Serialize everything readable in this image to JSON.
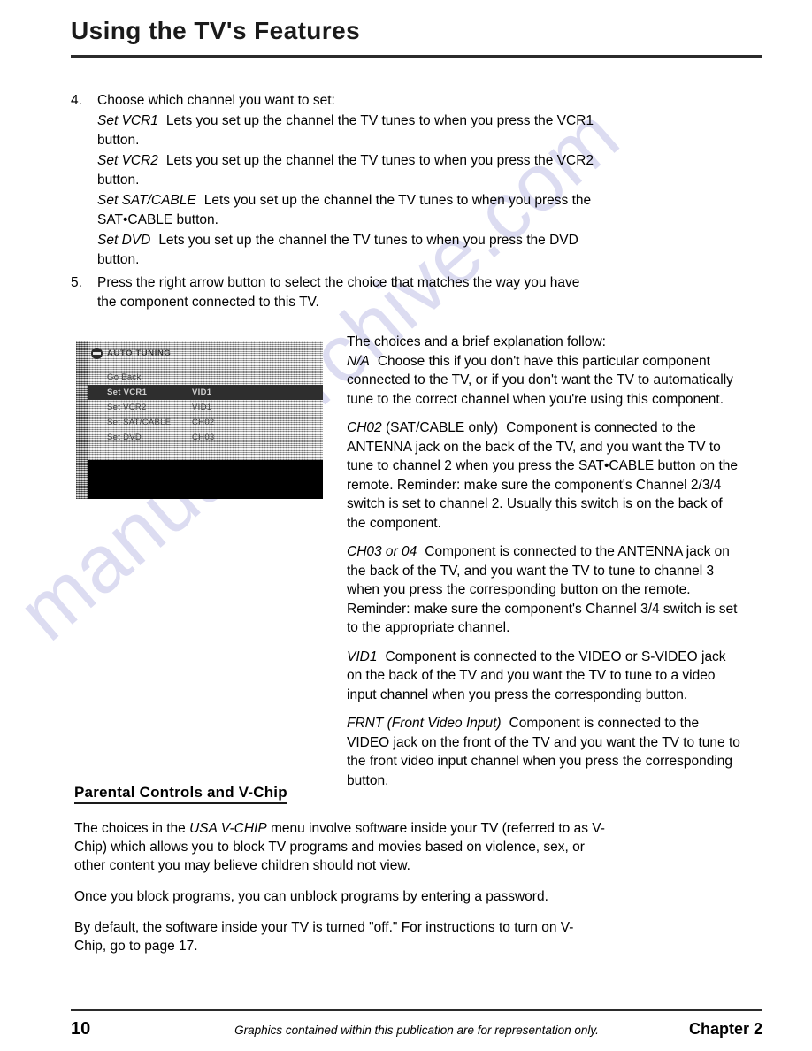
{
  "header": {
    "title": "Using the TV's Features"
  },
  "steps": [
    {
      "number": "4.",
      "text": "Choose which channel you want to set:"
    },
    {
      "number": "5.",
      "text": "Press the right arrow button to select the choice that matches the way you have the component connected to this TV."
    }
  ],
  "set_options": [
    {
      "term": "Set VCR1",
      "desc": "Lets you set up the channel the TV tunes to when you press the VCR1 button."
    },
    {
      "term": "Set VCR2",
      "desc": "Lets you set up the channel the TV tunes to when you press the VCR2 button."
    },
    {
      "term": "Set SAT/CABLE",
      "desc": "Lets you set up the channel the TV tunes to when you press the SAT•CABLE button."
    },
    {
      "term": "Set DVD",
      "desc": "Lets you set up the channel the TV tunes to when you press the DVD button."
    }
  ],
  "tv_menu": {
    "icon": "satellite-dish-icon",
    "title": "AUTO TUNING",
    "go_back": "Go Back",
    "rows": [
      {
        "label": "Set VCR1",
        "value": "VID1",
        "highlighted": true
      },
      {
        "label": "Set VCR2",
        "value": "VID1",
        "highlighted": false
      },
      {
        "label": "Set SAT/CABLE",
        "value": "CH02",
        "highlighted": false
      },
      {
        "label": "Set DVD",
        "value": "CH03",
        "highlighted": false
      }
    ]
  },
  "choices": {
    "intro": "The choices and a brief explanation follow:",
    "items": [
      {
        "term": "N/A",
        "term_plain": "",
        "text": "Choose this if you don't have this particular component connected to the TV, or if you don't want the TV to automatically tune to the correct channel when you're using this component."
      },
      {
        "term": "CH02",
        "term_plain": " (SAT/CABLE only)",
        "text": "Component is connected to the ANTENNA jack on the back of the TV, and you want the TV to tune to channel 2 when you press the SAT•CABLE button on the remote. Reminder: make sure the component's Channel 2/3/4 switch is set to channel 2. Usually this switch is on the back of the component."
      },
      {
        "term": "CH03 or 04",
        "term_plain": "",
        "text": "Component is connected to the ANTENNA jack on the back of the TV, and you want the TV to tune to channel 3 when you press the corresponding button on the remote. Reminder: make sure the component's Channel 3/4 switch is set to the appropriate channel."
      },
      {
        "term": "VID1",
        "term_plain": "",
        "text": "Component is connected to the VIDEO or S-VIDEO jack on the back of the TV and you want the TV to tune to a video input channel when you press the corresponding button."
      },
      {
        "term": "FRNT (Front Video Input)",
        "term_plain": "",
        "text": "Component is connected to the VIDEO jack on the front of the TV and you want the TV to tune to the front video input channel when you press the corresponding button."
      }
    ]
  },
  "parental": {
    "heading": "Parental Controls and V-Chip",
    "para1_a": "The choices in the ",
    "para1_em": "USA V-CHIP",
    "para1_b": " menu involve software inside your TV (referred to as V-Chip) which allows you to block TV programs and movies based on violence, sex, or other content you may believe children should not view.",
    "para2": "Once you block programs, you can unblock programs by entering a password.",
    "para3": "By default, the software inside your TV is turned \"off.\" For instructions to turn on V-Chip, go to page 17."
  },
  "footer": {
    "page_number": "10",
    "note": "Graphics contained within this publication are for representation only.",
    "chapter": "Chapter 2"
  },
  "watermark": {
    "text": "manualsarchive.com",
    "color": "#c8c8ea"
  }
}
